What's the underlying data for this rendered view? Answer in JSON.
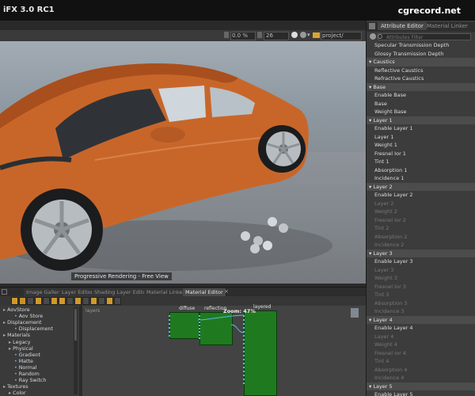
{
  "app": {
    "title": "iFX 3.0 RC1",
    "watermark": "cgrecord.net"
  },
  "viewport_toolbar": {
    "percent": "0.0 %",
    "value": "26",
    "project": "project/"
  },
  "viewport": {
    "label": "Progressive Rendering - Free View"
  },
  "attribute_editor": {
    "tabs": [
      "Attribute Editor",
      "Material Linker"
    ],
    "filter_placeholder": "Attributes Filter",
    "rows": [
      {
        "text": "Specular Transmission Depth",
        "kind": "on"
      },
      {
        "text": "Glossy Transmission Depth",
        "kind": "on"
      },
      {
        "text": "Caustics",
        "kind": "sec"
      },
      {
        "text": "Reflective Caustics",
        "kind": "on"
      },
      {
        "text": "Refractive Caustics",
        "kind": "on"
      },
      {
        "text": "Base",
        "kind": "sec"
      },
      {
        "text": "Enable Base",
        "kind": "on"
      },
      {
        "text": "Base",
        "kind": "on"
      },
      {
        "text": "Weight Base",
        "kind": "on"
      },
      {
        "text": "Layer 1",
        "kind": "sec"
      },
      {
        "text": "Enable Layer 1",
        "kind": "on"
      },
      {
        "text": "Layer 1",
        "kind": "on"
      },
      {
        "text": "Weight 1",
        "kind": "on"
      },
      {
        "text": "Fresnel Ior 1",
        "kind": "on"
      },
      {
        "text": "Tint 1",
        "kind": "on"
      },
      {
        "text": "Absorption 1",
        "kind": "on"
      },
      {
        "text": "Incidence 1",
        "kind": "on"
      },
      {
        "text": "Layer 2",
        "kind": "sec"
      },
      {
        "text": "Enable Layer 2",
        "kind": "on"
      },
      {
        "text": "Layer 2",
        "kind": "dim"
      },
      {
        "text": "Weight 2",
        "kind": "dim"
      },
      {
        "text": "Fresnel Ior 2",
        "kind": "dim"
      },
      {
        "text": "Tint 2",
        "kind": "dim"
      },
      {
        "text": "Absorption 2",
        "kind": "dim"
      },
      {
        "text": "Incidence 2",
        "kind": "dim"
      },
      {
        "text": "Layer 3",
        "kind": "sec"
      },
      {
        "text": "Enable Layer 3",
        "kind": "on"
      },
      {
        "text": "Layer 3",
        "kind": "dim"
      },
      {
        "text": "Weight 3",
        "kind": "dim"
      },
      {
        "text": "Fresnel Ior 3",
        "kind": "dim"
      },
      {
        "text": "Tint 3",
        "kind": "dim"
      },
      {
        "text": "Absorption 3",
        "kind": "dim"
      },
      {
        "text": "Incidence 3",
        "kind": "dim"
      },
      {
        "text": "Layer 4",
        "kind": "sec"
      },
      {
        "text": "Enable Layer 4",
        "kind": "on"
      },
      {
        "text": "Layer 4",
        "kind": "dim"
      },
      {
        "text": "Weight 4",
        "kind": "dim"
      },
      {
        "text": "Fresnel Ior 4",
        "kind": "dim"
      },
      {
        "text": "Tint 4",
        "kind": "dim"
      },
      {
        "text": "Absorption 4",
        "kind": "dim"
      },
      {
        "text": "Incidence 4",
        "kind": "dim"
      },
      {
        "text": "Layer 5",
        "kind": "sec"
      },
      {
        "text": "Enable Layer 5",
        "kind": "on"
      }
    ]
  },
  "bottom_tabs": [
    "Image Gallery",
    "Layer Editor",
    "Shading Layer Editor",
    "Material Linker",
    "Material Editor"
  ],
  "tree": [
    {
      "text": "AovStore",
      "indent": 0
    },
    {
      "text": "Aov Store",
      "indent": 2
    },
    {
      "text": "Displacement",
      "indent": 0
    },
    {
      "text": "Displacement",
      "indent": 2
    },
    {
      "text": "Materials",
      "indent": 0
    },
    {
      "text": "Legacy",
      "indent": 1
    },
    {
      "text": "Physical",
      "indent": 1
    },
    {
      "text": "Gradient",
      "indent": 2
    },
    {
      "text": "Matte",
      "indent": 2
    },
    {
      "text": "Normal",
      "indent": 2
    },
    {
      "text": "Random",
      "indent": 2
    },
    {
      "text": "Ray Switch",
      "indent": 2
    },
    {
      "text": "Textures",
      "indent": 0
    },
    {
      "text": "Color",
      "indent": 1
    }
  ],
  "graph": {
    "label": "layers",
    "zoom": "Zoom: 47%",
    "nodes": [
      {
        "name": "diffuse"
      },
      {
        "name": "reflection"
      },
      {
        "name": "layered"
      }
    ]
  },
  "colors": {
    "car": "#c8662a",
    "node": "#1f7a1f",
    "port": "#4fc1ff",
    "highlight": "#f0b030"
  }
}
